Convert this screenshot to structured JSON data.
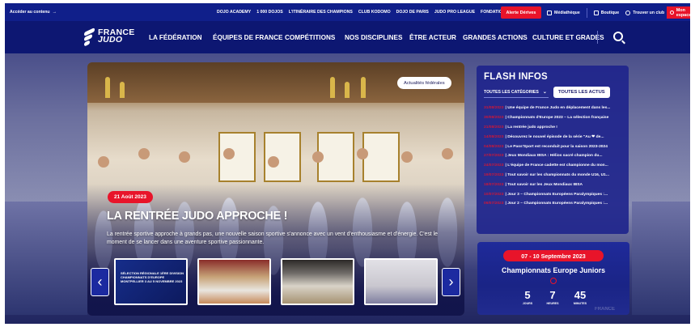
{
  "topbar": {
    "skip_link": "Accéder au contenu",
    "skip_arrow": "→",
    "links": [
      "DOJO ACADEMY",
      "1 000 DOJOS",
      "L'ITINÉRAIRE DES CHAMPIONS",
      "CLUB KODOMO",
      "DOJO DE PARIS",
      "JUDO PRO LEAGUE",
      "FONDATION FRANCE JUDO"
    ],
    "alerts_button": "Alerte Dérives",
    "mediatheque": "Médiathèque",
    "boutique": "Boutique",
    "find_club": "Trouver un club",
    "my_space": "Mon espace"
  },
  "nav": {
    "logo_line1": "FRANCE",
    "logo_line2": "JUDO",
    "items": [
      "LA FÉDÉRATION",
      "ÉQUIPES DE FRANCE",
      "COMPÉTITIONS",
      "NOS DISCIPLINES",
      "ÊTRE ACTEUR",
      "GRANDES ACTIONS",
      "CULTURE ET GRADES"
    ]
  },
  "hero": {
    "tag": "Actualités fédérales",
    "date": "21 Août 2023",
    "title": "LA RENTRÉE JUDO APPROCHE !",
    "lede": "La rentrée sportive approche à grands pas, une nouvelle saison sportive s'annonce avec un vent d'enthousiasme et d'énergie. C'est le moment de se lancer dans une aventure sportive passionnante.",
    "thumb1_text": "SÉLECTION RÉGIONALE 1ÈRE DIVISION CHAMPIONNATS D'EUROPE MONTPELLIER 3 AU 5 NOVEMBRE 2023",
    "prev": "‹",
    "next": "›"
  },
  "flash": {
    "title": "FLASH INFOS",
    "category_select": "TOUTES LES CATÉGORIES",
    "all_button": "TOUTES LES ACTUS",
    "items": [
      {
        "date": "31/08/2023",
        "text": "| Une équipe de France Judo en déplacement dans les..."
      },
      {
        "date": "30/08/2023",
        "text": "| Championnats d'Europe 2023 – La sélection française"
      },
      {
        "date": "21/08/2023",
        "text": "| La rentrée judo approche !"
      },
      {
        "date": "14/08/2023",
        "text": "| Découvrez le nouvel épisode de la série \"Au ❤ de..."
      },
      {
        "date": "04/08/2023",
        "text": "| Le Pass'Sport est reconduit pour la saison 2023-2024"
      },
      {
        "date": "27/07/2023",
        "text": "| Jeux Mondiaux IBSA : Hélios sacré champion du..."
      },
      {
        "date": "24/07/2023",
        "text": "| L'équipe de France cadette est championne du mon..."
      },
      {
        "date": "19/07/2023",
        "text": "| Tout savoir sur les championnats du monde U16, U1..."
      },
      {
        "date": "18/07/2023",
        "text": "| Tout savoir sur les Jeux Mondiaux IBSA"
      },
      {
        "date": "10/07/2023",
        "text": "| Jour 3 – Championnats Européens Paralympiques :..."
      },
      {
        "date": "09/07/2023",
        "text": "| Jour 2 – Championnats Européens Paralympiques :..."
      }
    ]
  },
  "event": {
    "dates": "07 - 10 Septembre 2023",
    "title": "Championnats Europe Juniors",
    "days": "5",
    "days_label": "JOURS",
    "hours": "7",
    "hours_label": "HEURES",
    "minutes": "45",
    "minutes_label": "MINUTES",
    "watermark": "FRANCE"
  }
}
